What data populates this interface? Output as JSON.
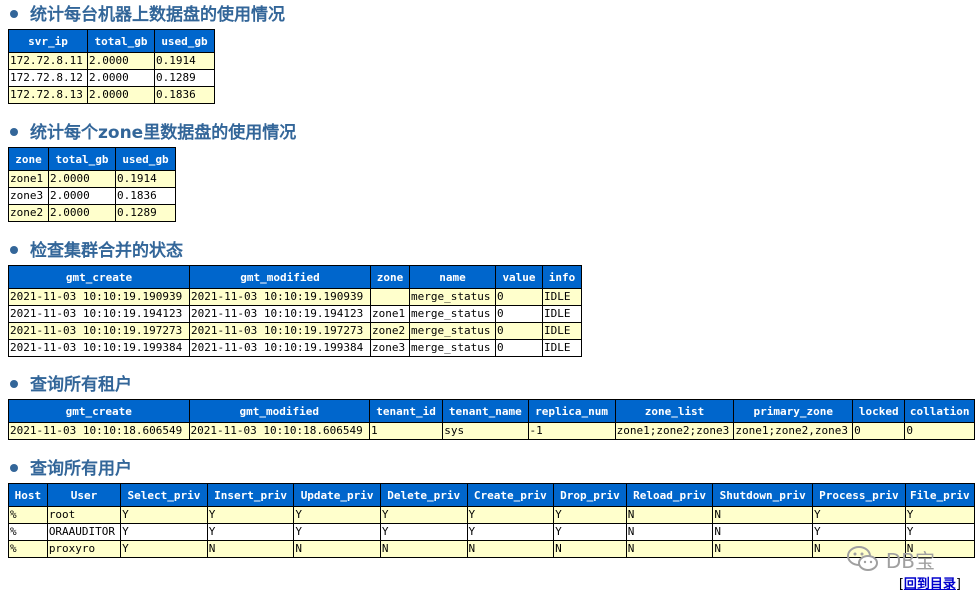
{
  "sections": [
    {
      "title": "统计每台机器上数据盘的使用情况",
      "columns": [
        "svr_ip",
        "total_gb",
        "used_gb"
      ],
      "rows": [
        [
          "172.72.8.11",
          "2.0000",
          "0.1914"
        ],
        [
          "172.72.8.12",
          "2.0000",
          "0.1289"
        ],
        [
          "172.72.8.13",
          "2.0000",
          "0.1836"
        ]
      ]
    },
    {
      "title": "统计每个zone里数据盘的使用情况",
      "columns": [
        "zone",
        "total_gb",
        "used_gb"
      ],
      "rows": [
        [
          "zone1",
          "2.0000",
          "0.1914"
        ],
        [
          "zone3",
          "2.0000",
          "0.1836"
        ],
        [
          "zone2",
          "2.0000",
          "0.1289"
        ]
      ]
    },
    {
      "title": "检查集群合并的状态",
      "columns": [
        "gmt_create",
        "gmt_modified",
        "zone",
        "name",
        "value",
        "info"
      ],
      "rows": [
        [
          "2021-11-03 10:10:19.190939",
          "2021-11-03 10:10:19.190939",
          "",
          "merge_status",
          "0",
          "IDLE"
        ],
        [
          "2021-11-03 10:10:19.194123",
          "2021-11-03 10:10:19.194123",
          "zone1",
          "merge_status",
          "0",
          "IDLE"
        ],
        [
          "2021-11-03 10:10:19.197273",
          "2021-11-03 10:10:19.197273",
          "zone2",
          "merge_status",
          "0",
          "IDLE"
        ],
        [
          "2021-11-03 10:10:19.199384",
          "2021-11-03 10:10:19.199384",
          "zone3",
          "merge_status",
          "0",
          "IDLE"
        ]
      ]
    },
    {
      "title": "查询所有租户",
      "columns": [
        "gmt_create",
        "gmt_modified",
        "tenant_id",
        "tenant_name",
        "replica_num",
        "zone_list",
        "primary_zone",
        "locked",
        "collation"
      ],
      "rows": [
        [
          "2021-11-03 10:10:18.606549",
          "2021-11-03 10:10:18.606549",
          "1",
          "sys",
          "-1",
          "zone1;zone2;zone3",
          "zone1;zone2,zone3",
          "0",
          "0"
        ]
      ]
    },
    {
      "title": "查询所有用户",
      "columns": [
        "Host",
        "User",
        "Select_priv",
        "Insert_priv",
        "Update_priv",
        "Delete_priv",
        "Create_priv",
        "Drop_priv",
        "Reload_priv",
        "Shutdown_priv",
        "Process_priv",
        "File_priv"
      ],
      "rows": [
        [
          "%",
          "root",
          "Y",
          "Y",
          "Y",
          "Y",
          "Y",
          "Y",
          "N",
          "N",
          "Y",
          "Y"
        ],
        [
          "%",
          "ORAAUDITOR",
          "Y",
          "Y",
          "Y",
          "Y",
          "Y",
          "Y",
          "N",
          "N",
          "Y",
          "Y"
        ],
        [
          "%",
          "proxyro",
          "Y",
          "N",
          "N",
          "N",
          "N",
          "N",
          "N",
          "N",
          "N",
          "N"
        ]
      ]
    }
  ],
  "watermark": {
    "text": "DB宝",
    "icon": "wechat-icon"
  },
  "back_link": {
    "open": "[",
    "label": "回到目录",
    "close": "]"
  }
}
